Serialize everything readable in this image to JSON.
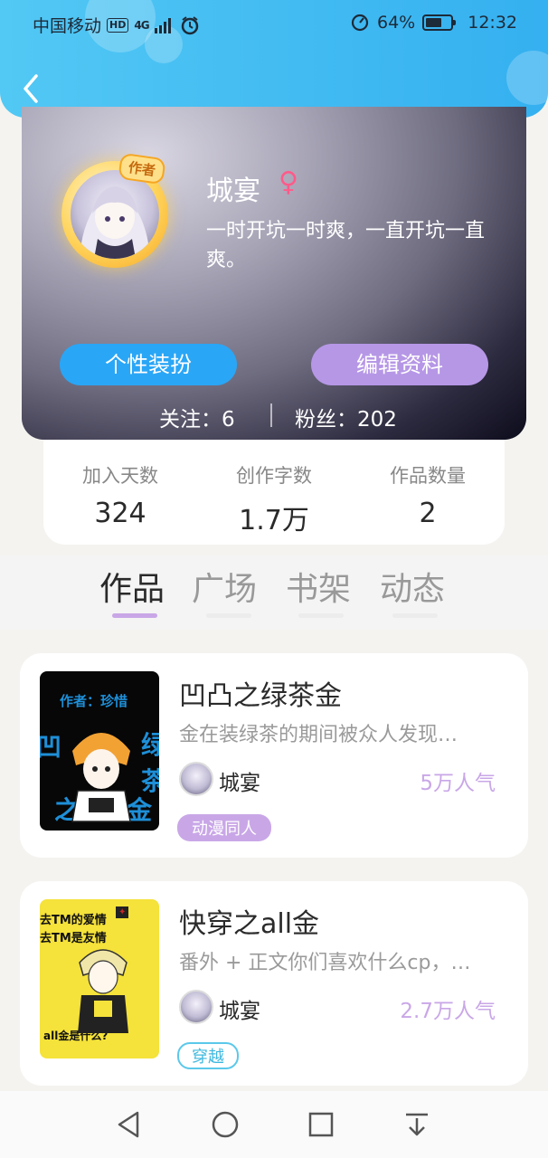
{
  "status_bar": {
    "carrier": "中国移动",
    "hd": "HD",
    "network": "4G",
    "battery_percent": "64%",
    "battery_level": 0.64,
    "time": "12:32"
  },
  "header": {
    "back_icon": "chevron-left-icon"
  },
  "profile": {
    "author_tag": "作者",
    "username": "城宴",
    "gender_symbol": "♀",
    "bio": "一时开坑一时爽，一直开坑一直爽。",
    "buttons": {
      "dress_up": "个性装扮",
      "edit_profile": "编辑资料"
    },
    "following_label": "关注：",
    "following": "6",
    "followers_label": "粉丝：",
    "followers": "202"
  },
  "stats": [
    {
      "label": "加入天数",
      "value": "324"
    },
    {
      "label": "创作字数",
      "value": "1.7万"
    },
    {
      "label": "作品数量",
      "value": "2"
    }
  ],
  "tabs": [
    {
      "label": "作品",
      "active": true
    },
    {
      "label": "广场",
      "active": false
    },
    {
      "label": "书架",
      "active": false
    },
    {
      "label": "动态",
      "active": false
    }
  ],
  "works": [
    {
      "cover_text_top": "作者：珍惜",
      "cover_text_left": "凹",
      "cover_text_right": "绿",
      "cover_text_right2": "茶",
      "cover_text_bottom_left": "之",
      "cover_text_bottom_right": "金",
      "title": "凹凸之绿茶金",
      "desc": "金在装绿茶的期间被众人发现…",
      "author": "城宴",
      "popularity": "5万人气",
      "tag": "动漫同人"
    },
    {
      "cover_text_1": "去TM的爱情",
      "cover_text_2": "去TM是友情",
      "cover_text_3": "all金是什么?",
      "title": "快穿之all金",
      "desc": "番外 + 正文你们喜欢什么cp，…",
      "author": "城宴",
      "popularity": "2.7万人气",
      "tag": "穿越"
    }
  ],
  "bottom_nav": [
    "back-triangle-icon",
    "home-circle-icon",
    "recents-square-icon",
    "notification-pull-icon"
  ]
}
